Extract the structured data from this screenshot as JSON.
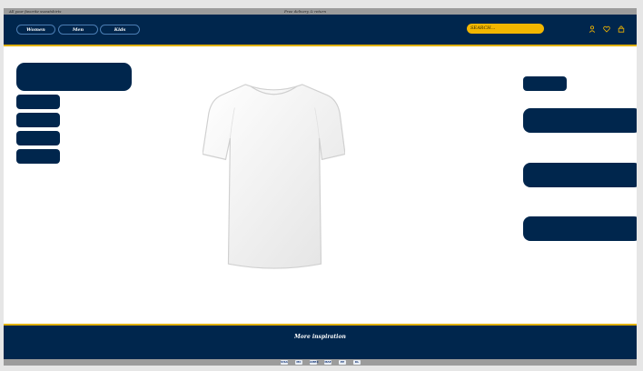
{
  "topbar": {
    "left_text": "All your favorite sweatshirts",
    "center_text": "Free delivery & return"
  },
  "nav": {
    "categories": [
      "Women",
      "Men",
      "Kids"
    ],
    "search_placeholder": "SEARCH..."
  },
  "footer": {
    "inspiration": "More inspiration"
  },
  "payments": [
    "VISA",
    "MC",
    "AMEX",
    "MAE",
    "PP",
    "KL"
  ],
  "colors": {
    "navy": "#00264d",
    "accent": "#f2b600",
    "border_gold": "#e0b000"
  }
}
